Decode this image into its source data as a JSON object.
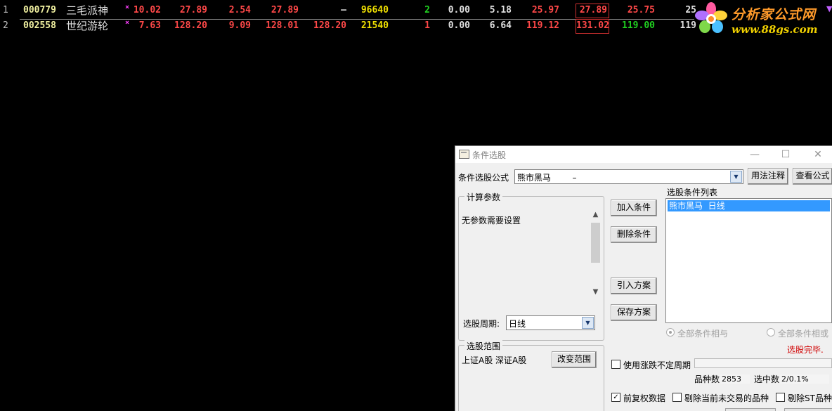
{
  "quotes": {
    "rows": [
      {
        "idx": "1",
        "code": "000779",
        "name": "三毛派神",
        "mark": "×",
        "values": [
          "10.02",
          "27.89",
          "2.54",
          "27.89",
          "–",
          "96640",
          "2",
          "0.00",
          "5.18",
          "25.97",
          "27.89",
          "25.75",
          "25"
        ]
      },
      {
        "idx": "2",
        "code": "002558",
        "name": "世纪游轮",
        "mark": "×",
        "values": [
          "7.63",
          "128.20",
          "9.09",
          "128.01",
          "128.20",
          "21540",
          "1",
          "0.00",
          "6.64",
          "119.12",
          "131.02",
          "119.00",
          "119"
        ]
      }
    ]
  },
  "logo": {
    "title": "分析家公式网",
    "url": "www.88gs.com"
  },
  "dialog": {
    "title": "条件选股",
    "formula_label": "条件选股公式",
    "formula_value": "熊市黑马        –",
    "usage_button": "用法注释",
    "view_formula_button": "查看公式",
    "calc_params_group": "计算参数",
    "no_params_text": "无参数需要设置",
    "period_label": "选股周期:",
    "period_value": "日线",
    "range_group": "选股范围",
    "range_value": "上证A股  深证A股",
    "change_range_button": "改变范围",
    "add_condition_button": "加入条件",
    "delete_condition_button": "删除条件",
    "import_plan_button": "引入方案",
    "save_plan_button": "保存方案",
    "condition_list_label": "选股条件列表",
    "condition_item": "熊市黑马  日线",
    "radio_and": "全部条件相与",
    "radio_or": "全部条件相或",
    "status": "选股完毕.",
    "use_unfixed_period": "使用涨跌不定周期",
    "count_label": "品种数",
    "count_value": "2853",
    "selected_label": "选中数",
    "selected_value": "2/0.1%",
    "forward_adjust": "前复权数据",
    "exclude_untraded": "剔除当前未交易的品种",
    "exclude_st": "剔除ST品种"
  },
  "colors": {
    "up": "#ff4848",
    "down": "#20d020",
    "volume": "#f0e000",
    "selection": "#3399ff",
    "status_red": "#d00000"
  }
}
